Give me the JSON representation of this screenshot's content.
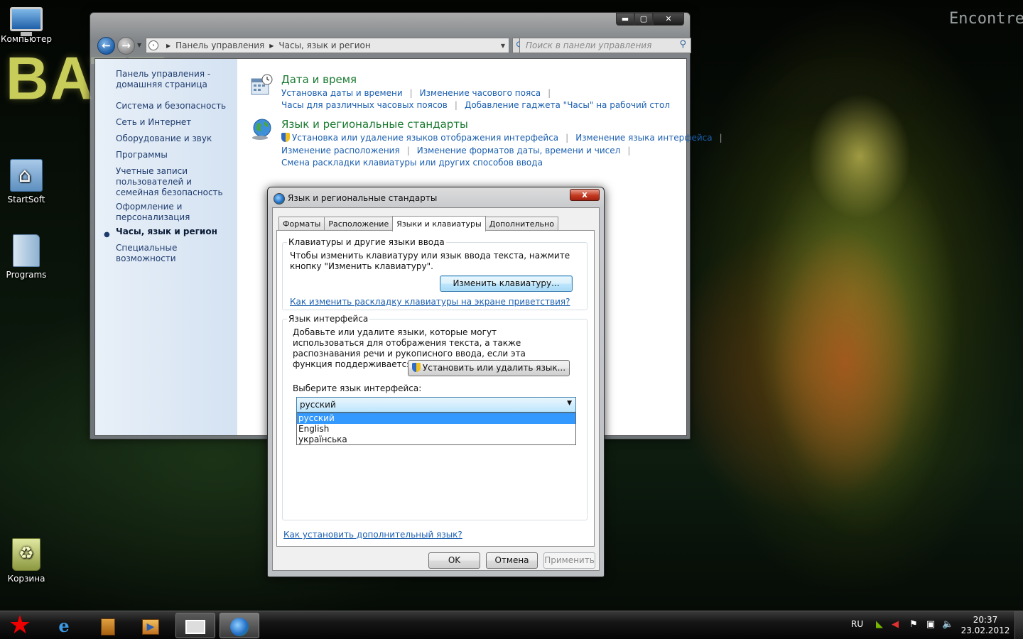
{
  "desktop": {
    "wallpaper_text_left": "BATT",
    "wallpaper_text_right": "Encontre Dic",
    "icons": [
      {
        "label": "Компьютер",
        "icon": "computer-icon"
      },
      {
        "label": "StartSoft",
        "icon": "folder-icon"
      },
      {
        "label": "Programs",
        "icon": "folder-icon"
      },
      {
        "label": "Корзина",
        "icon": "recycle-bin-icon"
      }
    ]
  },
  "control_panel": {
    "caption_buttons": {
      "minimize": "▬",
      "maximize": "▢",
      "close": "✕"
    },
    "address": {
      "crumbs": [
        "Панель управления",
        "Часы, язык и регион"
      ]
    },
    "search_placeholder": "Поиск в панели управления",
    "sidebar": {
      "items": [
        {
          "label": "Панель управления - домашняя страница"
        },
        {
          "label": "Система и безопасность"
        },
        {
          "label": "Сеть и Интернет"
        },
        {
          "label": "Оборудование и звук"
        },
        {
          "label": "Программы"
        },
        {
          "label": "Учетные записи пользователей и семейная безопасность"
        },
        {
          "label": "Оформление и персонализация"
        },
        {
          "label": "Часы, язык и регион",
          "active": true
        },
        {
          "label": "Специальные возможности"
        }
      ]
    },
    "categories": [
      {
        "title": "Дата и время",
        "icon": "calendar-clock-icon",
        "links": [
          "Установка даты и времени",
          "Изменение часового пояса",
          "Часы для различных часовых поясов",
          "Добавление гаджета \"Часы\" на рабочий стол"
        ]
      },
      {
        "title": "Язык и региональные стандарты",
        "icon": "globe-icon",
        "links": [
          "Установка или удаление языков отображения интерфейса",
          "Изменение языка интерфейса",
          "Изменение расположения",
          "Изменение форматов даты, времени и чисел",
          "Смена раскладки клавиатуры или других способов ввода"
        ]
      }
    ]
  },
  "dialog": {
    "title": "Язык и региональные стандарты",
    "close_label": "x",
    "tabs": [
      "Форматы",
      "Расположение",
      "Языки и клавиатуры",
      "Дополнительно"
    ],
    "selected_tab": "Языки и клавиатуры",
    "keyboards_group": {
      "label": "Клавиатуры и другие языки ввода",
      "description": "Чтобы изменить клавиатуру или язык ввода текста, нажмите кнопку \"Изменить клавиатуру\".",
      "button": "Изменить клавиатуру...",
      "link": "Как изменить раскладку клавиатуры на экране приветствия?"
    },
    "display_language_group": {
      "label": "Язык интерфейса",
      "description": "Добавьте или удалите языки, которые могут использоваться для отображения текста, а также распознавания речи и рукописного ввода, если эта функция поддерживается.",
      "button": "Установить или удалить язык...",
      "select_label": "Выберите язык интерфейса:",
      "selected_value": "русский",
      "options": [
        "русский",
        "English",
        "українська"
      ]
    },
    "bottom_link": "Как установить дополнительный язык?",
    "buttons": {
      "ok": "OK",
      "cancel": "Отмена",
      "apply": "Применить"
    }
  },
  "taskbar": {
    "language": "RU",
    "time": "20:37",
    "date": "23.02.2012"
  }
}
